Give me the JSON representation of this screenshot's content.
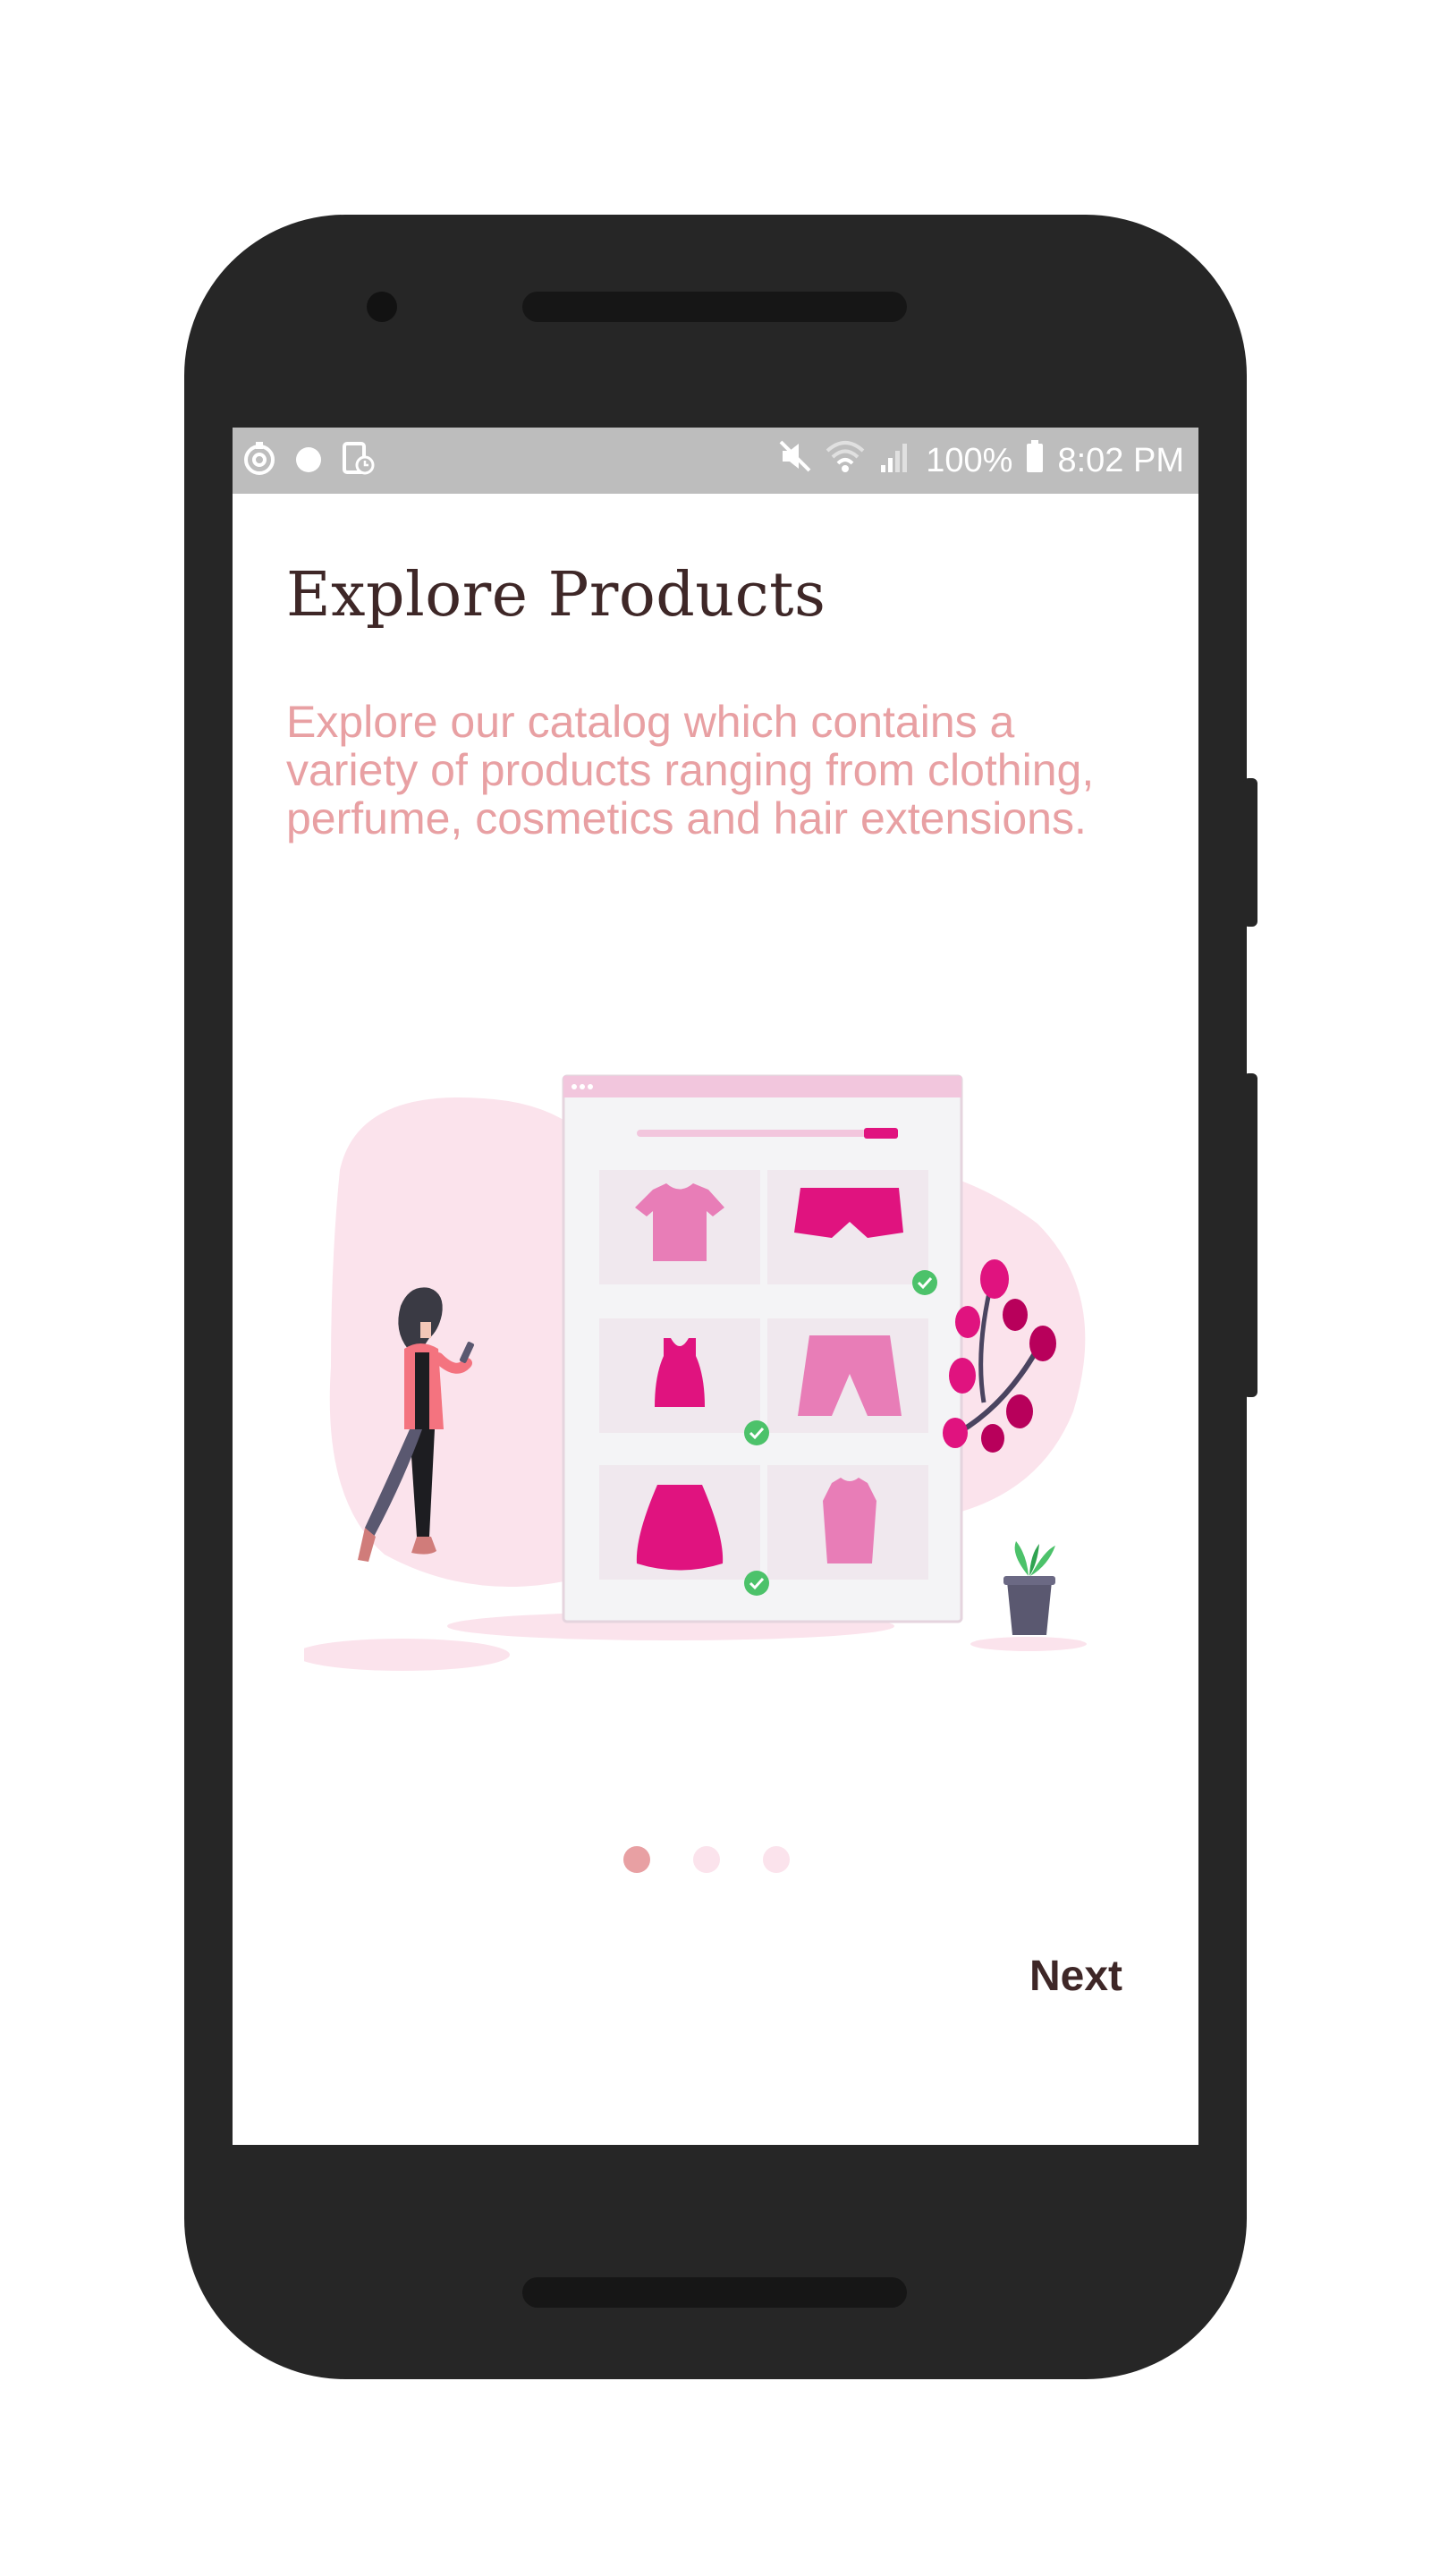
{
  "status_bar": {
    "battery_text": "100%",
    "time": "8:02 PM",
    "left_icons": [
      "sync-icon",
      "circle-icon",
      "screenshot-icon"
    ],
    "right_icons": [
      "mute-icon",
      "wifi-icon",
      "signal-icon",
      "battery-icon"
    ]
  },
  "onboarding": {
    "title": "Explore Products",
    "description": "Explore our catalog which contains a variety of products ranging from clothing, perfume, cosmetics and hair extensions.",
    "page_indicator": {
      "total": 3,
      "active": 1
    },
    "next_label": "Next"
  },
  "colors": {
    "title": "#3e2727",
    "description": "#e8a0a3",
    "accent": "#e0137f",
    "dot_active": "#e8a0a3",
    "dot_inactive": "#fbe3ec",
    "status_bar": "#bdbdbd",
    "phone_body": "#262626"
  }
}
